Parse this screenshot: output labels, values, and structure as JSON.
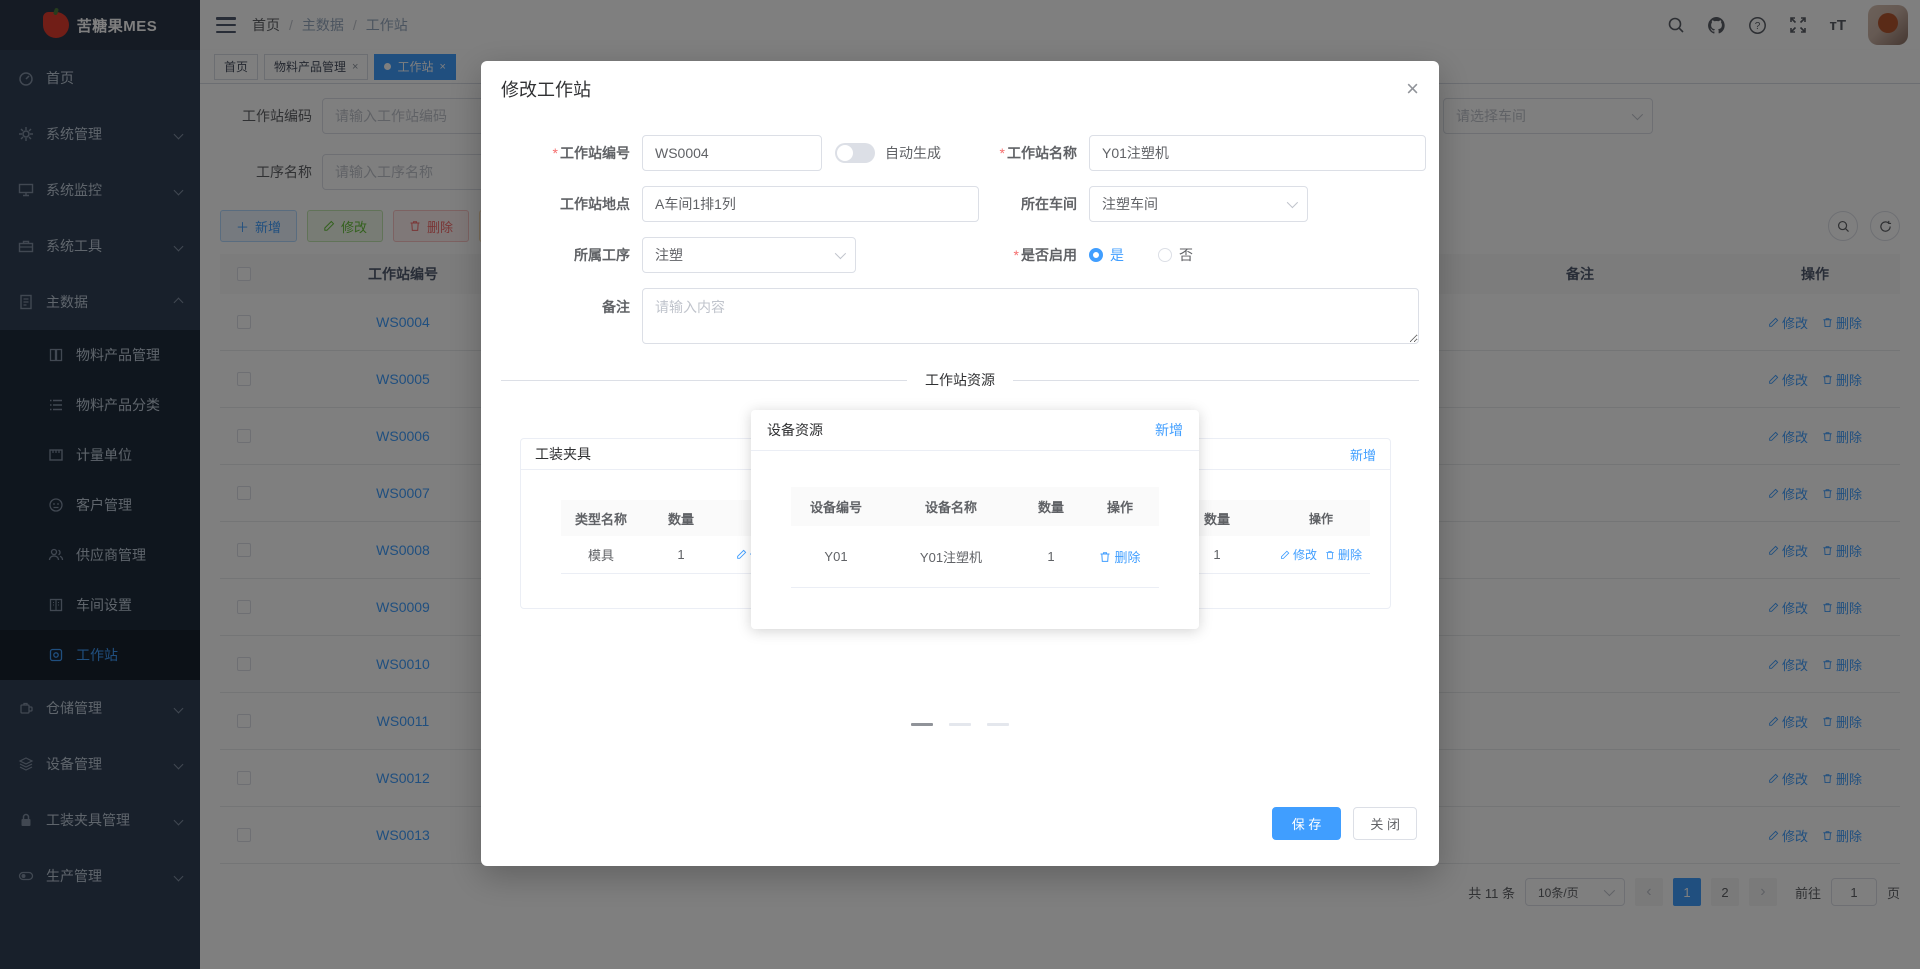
{
  "app": {
    "logo_text": "苦糖果MES"
  },
  "header": {
    "breadcrumb": [
      "首页",
      "主数据",
      "工作站"
    ],
    "separator": "/"
  },
  "tabs": {
    "close_glyph": "×",
    "items": [
      {
        "label": "首页"
      },
      {
        "label": "物料产品管理"
      },
      {
        "label": "工作站"
      }
    ]
  },
  "sidebar": {
    "items": [
      {
        "label": "首页"
      },
      {
        "label": "系统管理"
      },
      {
        "label": "系统监控"
      },
      {
        "label": "系统工具"
      },
      {
        "label": "主数据"
      },
      {
        "label": "仓储管理"
      },
      {
        "label": "设备管理"
      },
      {
        "label": "工装夹具管理"
      },
      {
        "label": "生产管理"
      }
    ],
    "master_children": [
      {
        "label": "物料产品管理"
      },
      {
        "label": "物料产品分类"
      },
      {
        "label": "计量单位"
      },
      {
        "label": "客户管理"
      },
      {
        "label": "供应商管理"
      },
      {
        "label": "车间设置"
      },
      {
        "label": "工作站"
      }
    ]
  },
  "search": {
    "code_label": "工作站编码",
    "code_placeholder": "请输入工作站编码",
    "process_label": "工序名称",
    "process_placeholder": "请输入工序名称",
    "workshop_placeholder": "请选择车间"
  },
  "toolbar": {
    "add": "新增",
    "edit": "修改",
    "delete": "删除"
  },
  "table": {
    "header_code": "工作站编号",
    "header_remark": "备注",
    "header_action": "操作",
    "rows": [
      {
        "code": "WS0004"
      },
      {
        "code": "WS0005"
      },
      {
        "code": "WS0006"
      },
      {
        "code": "WS0007"
      },
      {
        "code": "WS0008"
      },
      {
        "code": "WS0009"
      },
      {
        "code": "WS0010"
      },
      {
        "code": "WS0011"
      },
      {
        "code": "WS0012"
      },
      {
        "code": "WS0013"
      }
    ],
    "row_edit": "修改",
    "row_delete": "删除"
  },
  "pagination": {
    "total": "共 11 条",
    "page_size": "10条/页",
    "prev": "‹",
    "next": "›",
    "page1": "1",
    "page2": "2",
    "goto_label": "前往",
    "goto_value": "1",
    "page_unit": "页"
  },
  "modal": {
    "title": "修改工作站",
    "close_glyph": "×",
    "required_mark": "*",
    "fields": {
      "code_label": "工作站编号",
      "code_value": "WS0004",
      "auto_generate_label": "自动生成",
      "name_label": "工作站名称",
      "name_value": "Y01注塑机",
      "location_label": "工作站地点",
      "location_value": "A车间1排1列",
      "workshop_label": "所在车间",
      "workshop_value": "注塑车间",
      "process_label": "所属工序",
      "process_value": "注塑",
      "enabled_label": "是否启用",
      "enabled_yes": "是",
      "enabled_no": "否",
      "remark_label": "备注",
      "remark_placeholder": "请输入内容"
    },
    "resources": {
      "divider_title": "工作站资源",
      "fixture": {
        "title": "工装夹具",
        "col_type": "类型名称",
        "col_qty": "数量",
        "row_type": "模具",
        "row_qty": "1",
        "edit": "修改"
      },
      "device": {
        "title": "设备资源",
        "add": "新增",
        "col_code": "设备编号",
        "col_name": "设备名称",
        "col_qty": "数量",
        "col_action": "操作",
        "row_code": "Y01",
        "row_name": "Y01注塑机",
        "row_qty": "1",
        "delete": "删除"
      },
      "staff": {
        "add": "新增",
        "col_qty": "数量",
        "col_action": "操作",
        "row_qty": "1",
        "edit": "修改",
        "delete": "删除"
      }
    },
    "save": "保 存",
    "close": "关 闭"
  }
}
